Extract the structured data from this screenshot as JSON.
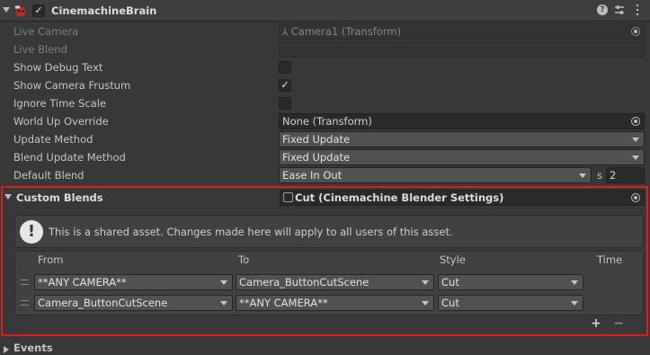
{
  "component": {
    "title": "CinemachineBrain",
    "enabled_mark": "✓"
  },
  "properties": {
    "live_camera": {
      "label": "Live Camera",
      "value": "Camera1 (Transform)"
    },
    "live_blend": {
      "label": "Live Blend",
      "value": ""
    },
    "show_debug_text": {
      "label": "Show Debug Text",
      "checked": ""
    },
    "show_camera_frustum": {
      "label": "Show Camera Frustum",
      "checked": "✓"
    },
    "ignore_time_scale": {
      "label": "Ignore Time Scale",
      "checked": ""
    },
    "world_up_override": {
      "label": "World Up Override",
      "value": "None (Transform)"
    },
    "update_method": {
      "label": "Update Method",
      "value": "Fixed Update"
    },
    "blend_update_method": {
      "label": "Blend Update Method",
      "value": "Fixed Update"
    },
    "default_blend": {
      "label": "Default Blend",
      "value": "Ease In Out",
      "unit": "s",
      "time": "2"
    }
  },
  "custom_blends": {
    "label": "Custom Blends",
    "asset": "Cut (Cinemachine Blender Settings)",
    "info": "This is a shared asset.  Changes made here will apply to all users of this asset.",
    "columns": {
      "from": "From",
      "to": "To",
      "style": "Style",
      "time": "Time"
    },
    "rows": [
      {
        "from": "**ANY CAMERA**",
        "to": "Camera_ButtonCutScene",
        "style": "Cut"
      },
      {
        "from": "Camera_ButtonCutScene",
        "to": "**ANY CAMERA**",
        "style": "Cut"
      }
    ],
    "add_label": "+",
    "remove_label": "−"
  },
  "next_section": {
    "label": "Events"
  },
  "colors": {
    "highlight": "#e01b1b",
    "background": "#383838"
  }
}
